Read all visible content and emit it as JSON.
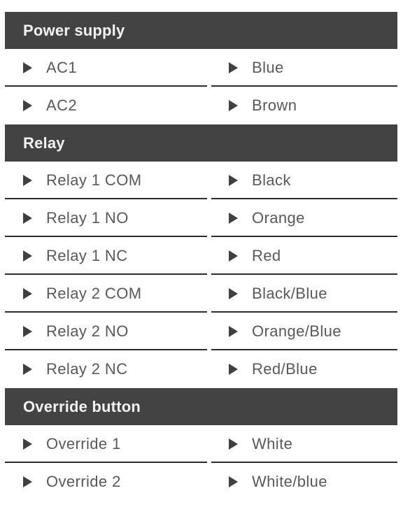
{
  "colors": {
    "header_bar": "#434343",
    "header_text": "#f2f2f2",
    "row_text": "#595959",
    "divider": "#2b2b2b",
    "marker": "#404040",
    "background": "#ffffff"
  },
  "icons": {
    "marker": "triangle-right-icon"
  },
  "sections": [
    {
      "title": "Power supply",
      "rows": [
        {
          "terminal": "AC1",
          "wire": "Blue"
        },
        {
          "terminal": "AC2",
          "wire": "Brown"
        }
      ]
    },
    {
      "title": "Relay",
      "rows": [
        {
          "terminal": "Relay 1 COM",
          "wire": "Black"
        },
        {
          "terminal": "Relay 1 NO",
          "wire": "Orange"
        },
        {
          "terminal": "Relay 1 NC",
          "wire": "Red"
        },
        {
          "terminal": "Relay 2 COM",
          "wire": "Black/Blue"
        },
        {
          "terminal": "Relay 2 NO",
          "wire": "Orange/Blue"
        },
        {
          "terminal": "Relay 2 NC",
          "wire": "Red/Blue"
        }
      ]
    },
    {
      "title": "Override button",
      "rows": [
        {
          "terminal": "Override 1",
          "wire": "White"
        },
        {
          "terminal": "Override 2",
          "wire": "White/blue"
        }
      ]
    }
  ]
}
